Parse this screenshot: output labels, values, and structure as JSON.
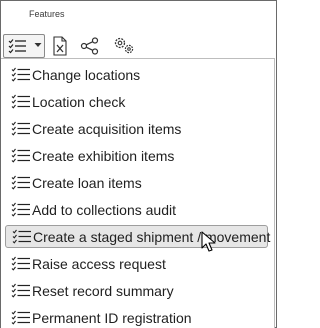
{
  "toolbar": {
    "group_label": "Features",
    "list_icon": "list-checks-icon",
    "export_icon": "excel-export-icon",
    "share_icon": "share-icon",
    "settings_icon": "gears-icon"
  },
  "menu": {
    "items": [
      {
        "label": "Change locations",
        "icon": "list-checks-icon"
      },
      {
        "label": "Location check",
        "icon": "list-checks-icon"
      },
      {
        "label": "Create acquisition items",
        "icon": "list-checks-icon"
      },
      {
        "label": "Create exhibition items",
        "icon": "list-checks-icon"
      },
      {
        "label": "Create loan items",
        "icon": "list-checks-icon"
      },
      {
        "label": "Add to collections audit",
        "icon": "list-checks-icon"
      },
      {
        "label": "Create a staged shipment / movement",
        "icon": "list-checks-icon",
        "highlighted": true
      },
      {
        "label": "Raise access request",
        "icon": "list-checks-icon"
      },
      {
        "label": "Reset record summary",
        "icon": "list-checks-icon"
      },
      {
        "label": "Permanent ID registration",
        "icon": "list-checks-icon"
      }
    ]
  },
  "colors": {
    "highlight_bg": "#e6e6e6",
    "highlight_border": "#9e9e9e",
    "text": "#1f1f1f"
  }
}
